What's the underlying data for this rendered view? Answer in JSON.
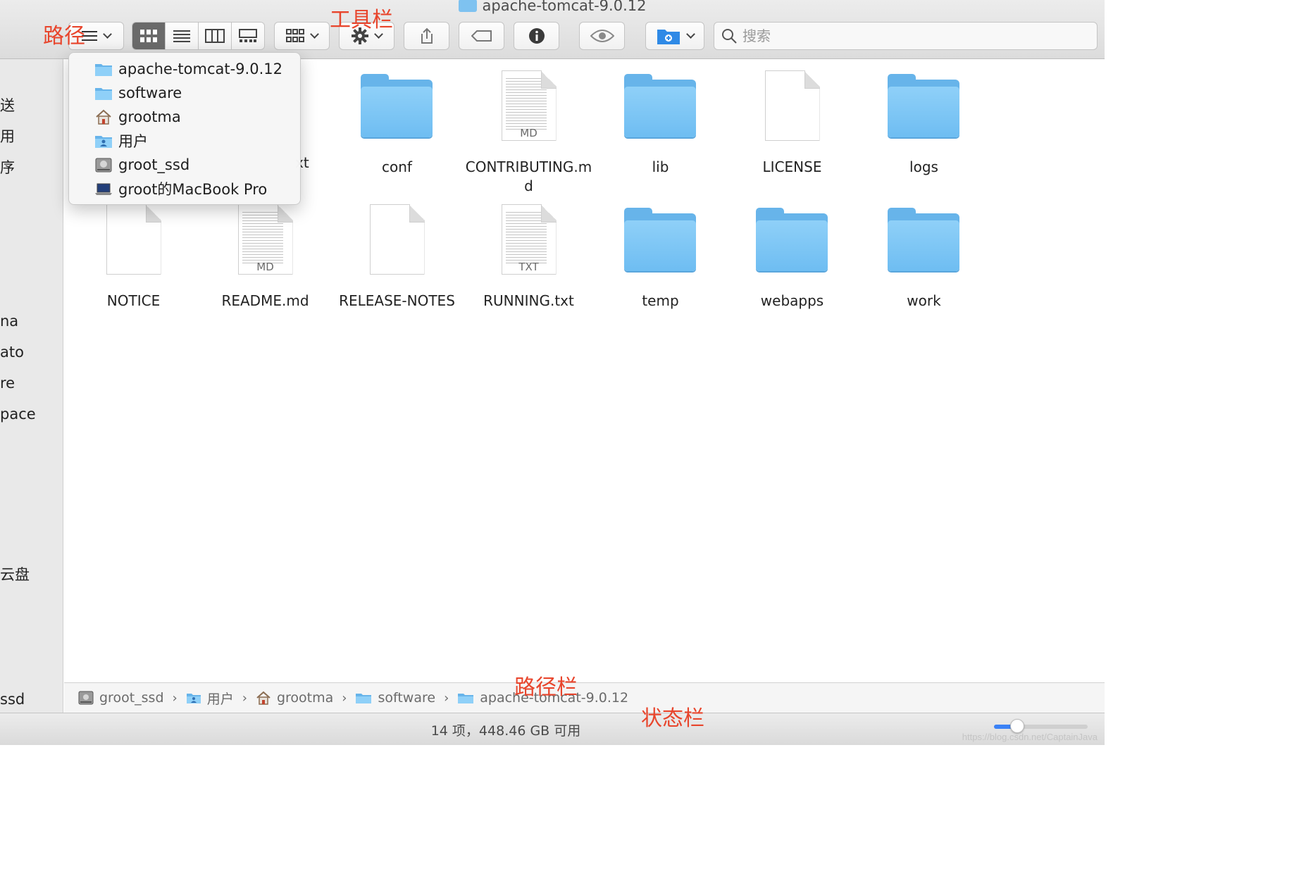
{
  "window": {
    "title": "apache-tomcat-9.0.12"
  },
  "toolbar": {
    "search_placeholder": "搜索",
    "annotations": {
      "path": "路径",
      "toolbar": "工具栏",
      "path_bar": "路径栏",
      "status_bar": "状态栏"
    }
  },
  "path_menu": {
    "items": [
      {
        "label": "apache-tomcat-9.0.12",
        "icon": "folder-icon"
      },
      {
        "label": "software",
        "icon": "folder-icon"
      },
      {
        "label": "grootma",
        "icon": "home-icon"
      },
      {
        "label": "用户",
        "icon": "users-folder-icon"
      },
      {
        "label": "groot_ssd",
        "icon": "drive-icon"
      },
      {
        "label": "groot的MacBook Pro",
        "icon": "laptop-icon"
      }
    ]
  },
  "sidebar": {
    "items": [
      "送",
      "用",
      "序",
      "na",
      "ato",
      "re",
      "pace",
      "云盘",
      "ssd"
    ]
  },
  "files": [
    {
      "name": "conf",
      "kind": "folder"
    },
    {
      "name": "CONTRIBUTING.md",
      "kind": "doc",
      "ext": "MD"
    },
    {
      "name": "lib",
      "kind": "folder"
    },
    {
      "name": "LICENSE",
      "kind": "blank"
    },
    {
      "name": "logs",
      "kind": "folder"
    },
    {
      "name": "NOTICE",
      "kind": "blank"
    },
    {
      "name": "README.md",
      "kind": "doc",
      "ext": "MD"
    },
    {
      "name": "RELEASE-NOTES",
      "kind": "blank"
    },
    {
      "name": "RUNNING.txt",
      "kind": "doc",
      "ext": "TXT"
    },
    {
      "name": "temp",
      "kind": "folder"
    },
    {
      "name": "webapps",
      "kind": "folder"
    },
    {
      "name": "work",
      "kind": "folder"
    }
  ],
  "partial_label": "xt",
  "path_bar": {
    "segments": [
      {
        "label": "groot_ssd",
        "icon": "drive-icon"
      },
      {
        "label": "用户",
        "icon": "users-folder-icon"
      },
      {
        "label": "grootma",
        "icon": "home-icon"
      },
      {
        "label": "software",
        "icon": "folder-icon"
      },
      {
        "label": "apache-tomcat-9.0.12",
        "icon": "folder-icon"
      }
    ]
  },
  "status": {
    "text": "14 项，448.46 GB 可用",
    "icon_size_fraction": 0.25
  },
  "watermark": "https://blog.csdn.net/CaptainJava",
  "colors": {
    "accent": "#3b82f6",
    "folder": "#6ebdf2",
    "annotation": "#e8452c"
  }
}
